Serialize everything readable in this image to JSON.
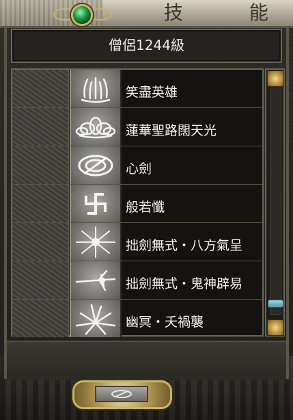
{
  "window": {
    "title": "技 能"
  },
  "header": {
    "character_label": "僧侶1244級"
  },
  "skills": [
    {
      "name": "笑盡英雄",
      "icon": "flame-burst-icon"
    },
    {
      "name": "蓮華聖路闊天光",
      "icon": "lotus-icon"
    },
    {
      "name": "心劍",
      "icon": "sword-ring-icon"
    },
    {
      "name": "般若懺",
      "icon": "swastika-icon"
    },
    {
      "name": "拙劍無式・八方氣呈",
      "icon": "radiant-burst-icon"
    },
    {
      "name": "拙劍無式・鬼神辟易",
      "icon": "sword-comet-icon"
    },
    {
      "name": "幽冥・夭禍襲",
      "icon": "spike-burst-icon"
    }
  ],
  "scrollbar": {
    "up_icon": "scroll-up-icon",
    "down_icon": "scroll-down-icon",
    "position": 0.95
  },
  "footer": {
    "confirm_icon": "confirm-emblem-icon"
  },
  "colors": {
    "text": "#f4f3ee",
    "frame": "#6b665a",
    "gem": "#1f9a45",
    "gold": "#c9b46a"
  }
}
